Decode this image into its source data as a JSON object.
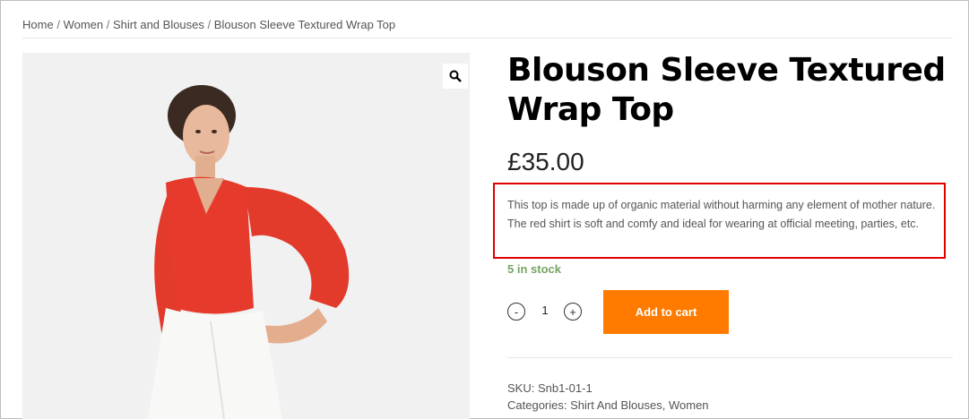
{
  "breadcrumb": {
    "items": [
      "Home",
      "Women",
      "Shirt and Blouses",
      "Blouson Sleeve Textured Wrap Top"
    ],
    "separator": "/"
  },
  "product": {
    "title_line1": "Blouson Sleeve Textured",
    "title_line2": "Wrap Top",
    "price": "£35.00",
    "description": "This top is made up of organic material without harming any element of mother nature. The red shirt is soft and comfy and ideal for wearing at official meeting, parties, etc.",
    "stock": "5 in stock",
    "quantity": "1",
    "minus_label": "-",
    "plus_label": "+",
    "add_to_cart_label": "Add to cart",
    "sku_label": "SKU:",
    "sku_value": "Snb1-01-1",
    "categories_label": "Categories:",
    "categories": [
      "Shirt And Blouses",
      "Women"
    ]
  },
  "icons": {
    "zoom": "magnifier-icon"
  },
  "colors": {
    "accent": "#ff7b00",
    "stock": "#77a464",
    "highlight": "#e00000"
  }
}
